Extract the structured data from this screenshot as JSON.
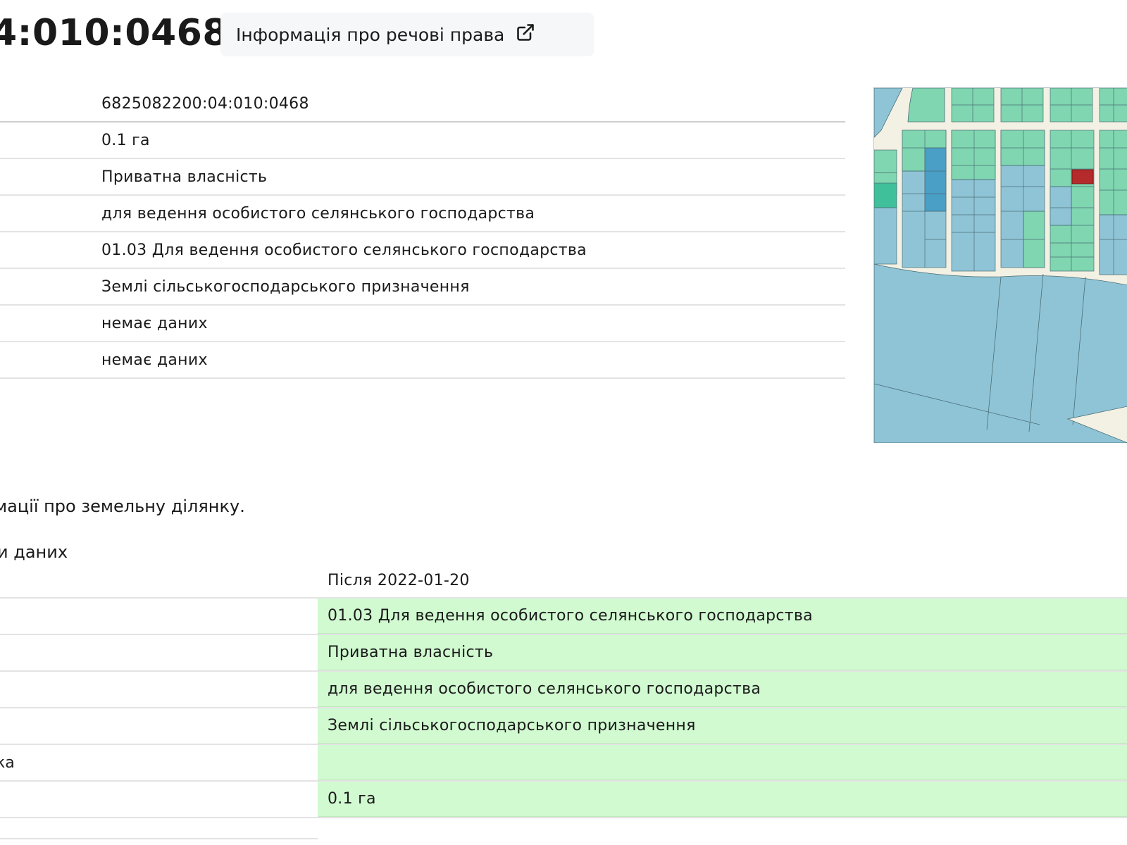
{
  "header": {
    "title": "4:010:0468",
    "rights_link_label": "Інформація про речові права"
  },
  "info_rows": [
    {
      "value": "6825082200:04:010:0468"
    },
    {
      "value": "0.1 га"
    },
    {
      "value": "Приватна власність"
    },
    {
      "value": "для ведення особистого селянського господарства"
    },
    {
      "value": "01.03 Для ведення особистого селянського господарства"
    },
    {
      "value": "Землі сільськогосподарського призначення"
    },
    {
      "value": "немає даних"
    },
    {
      "value": "немає даних"
    }
  ],
  "notice_text": "мації про земельну ділянку.",
  "history": {
    "title": "и даних",
    "after_header": "Після 2022-01-20",
    "rows": [
      {
        "left": "",
        "after": "01.03 Для ведення особистого селянського господарства"
      },
      {
        "left": "",
        "after": "Приватна власність"
      },
      {
        "left": "",
        "after": "для ведення особистого селянського господарства"
      },
      {
        "left": "",
        "after": "Землі сільськогосподарського призначення"
      },
      {
        "left": "ка",
        "after": ""
      },
      {
        "left": "",
        "after": "0.1 га"
      }
    ]
  },
  "map": {
    "selected_parcel_color": "#b52a2a",
    "parcel_green": "#7fd6b0",
    "parcel_blue": "#8fc4d6",
    "road_color": "#f3f1e4"
  }
}
